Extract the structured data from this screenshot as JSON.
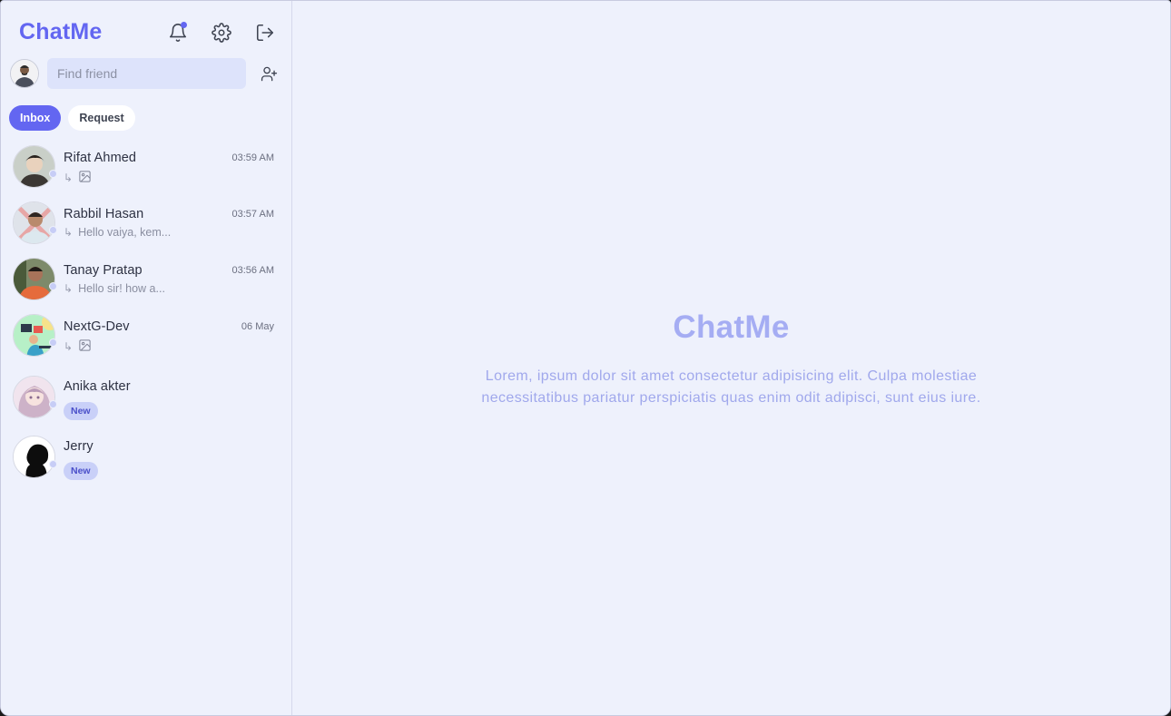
{
  "app": {
    "brand": "ChatMe"
  },
  "header": {
    "icons": [
      "bell-icon",
      "gear-icon",
      "logout-icon"
    ],
    "accent": "#6366f1"
  },
  "search": {
    "placeholder": "Find friend",
    "value": ""
  },
  "tabs": [
    {
      "label": "Inbox",
      "active": true
    },
    {
      "label": "Request",
      "active": false
    }
  ],
  "conversations": [
    {
      "name": "Rifat Ahmed",
      "time": "03:59 AM",
      "preview": "",
      "preview_type": "image"
    },
    {
      "name": "Rabbil Hasan",
      "time": "03:57 AM",
      "preview": "Hello vaiya, kem...",
      "preview_type": "text"
    },
    {
      "name": "Tanay Pratap",
      "time": "03:56 AM",
      "preview": "Hello sir! how a...",
      "preview_type": "text"
    },
    {
      "name": "NextG-Dev",
      "time": "06 May",
      "preview": "",
      "preview_type": "image"
    },
    {
      "name": "Anika akter",
      "time": "",
      "badge": "New"
    },
    {
      "name": "Jerry",
      "time": "",
      "badge": "New"
    }
  ],
  "reply_glyph": "↳",
  "main": {
    "title": "ChatMe",
    "description": "Lorem, ipsum dolor sit amet consectetur adipisicing elit. Culpa molestiae necessitatibus pariatur perspiciatis quas enim odit adipisci, sunt eius iure."
  }
}
